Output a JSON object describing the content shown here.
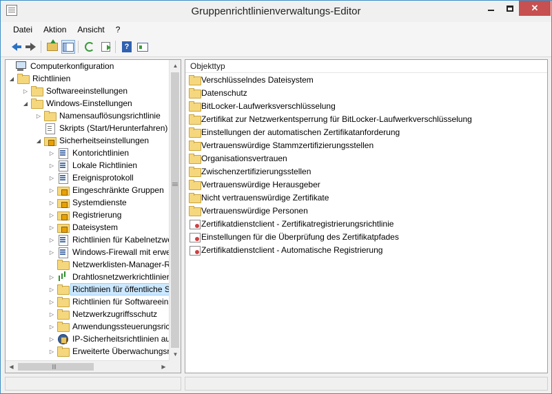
{
  "window": {
    "title": "Gruppenrichtlinienverwaltungs-Editor"
  },
  "menu": [
    {
      "label": "Datei"
    },
    {
      "label": "Aktion"
    },
    {
      "label": "Ansicht"
    },
    {
      "label": "?"
    }
  ],
  "toolbar": {
    "buttons": [
      "back-icon",
      "forward-icon",
      "folder-up-icon",
      "show-hide-tree-icon",
      "refresh-icon",
      "export-list-icon",
      "help-icon",
      "properties-icon"
    ]
  },
  "tree": {
    "items": [
      {
        "label": "Computerkonfiguration",
        "icon": "computer-icon",
        "expander": ""
      },
      {
        "label": "Richtlinien",
        "icon": "folder-icon",
        "expander": "◢"
      },
      {
        "label": "Softwareeinstellungen",
        "icon": "folder-icon",
        "expander": "▷"
      },
      {
        "label": "Windows-Einstellungen",
        "icon": "folder-icon",
        "expander": "◢"
      },
      {
        "label": "Namensauflösungsrichtlinie",
        "icon": "folder-icon",
        "expander": "▷"
      },
      {
        "label": "Skripts (Start/Herunterfahren)",
        "icon": "script-icon",
        "expander": ""
      },
      {
        "label": "Sicherheitseinstellungen",
        "icon": "security-folder-icon",
        "expander": "◢"
      },
      {
        "label": "Kontorichtlinien",
        "icon": "policy-icon",
        "expander": "▷"
      },
      {
        "label": "Lokale Richtlinien",
        "icon": "policy-icon",
        "expander": "▷"
      },
      {
        "label": "Ereignisprotokoll",
        "icon": "policy-icon",
        "expander": "▷"
      },
      {
        "label": "Eingeschränkte Gruppen",
        "icon": "security-folder-icon",
        "expander": "▷"
      },
      {
        "label": "Systemdienste",
        "icon": "security-folder-icon",
        "expander": "▷"
      },
      {
        "label": "Registrierung",
        "icon": "security-folder-icon",
        "expander": "▷"
      },
      {
        "label": "Dateisystem",
        "icon": "security-folder-icon",
        "expander": "▷"
      },
      {
        "label": "Richtlinien für Kabelnetzwe",
        "icon": "policy-icon",
        "expander": "▷"
      },
      {
        "label": "Windows-Firewall mit erwe",
        "icon": "policy-icon",
        "expander": "▷"
      },
      {
        "label": "Netzwerklisten-Manager-R",
        "icon": "folder-icon",
        "expander": ""
      },
      {
        "label": "Drahtlosnetzwerkrichtlinier",
        "icon": "wireless-icon",
        "expander": "▷"
      },
      {
        "label": "Richtlinien für öffentliche S",
        "icon": "folder-icon",
        "expander": "▷",
        "selected": true
      },
      {
        "label": "Richtlinien für Softwareeins",
        "icon": "folder-icon",
        "expander": "▷"
      },
      {
        "label": "Netzwerkzugriffsschutz",
        "icon": "folder-icon",
        "expander": "▷"
      },
      {
        "label": "Anwendungssteuerungsric",
        "icon": "folder-icon",
        "expander": "▷"
      },
      {
        "label": "IP-Sicherheitsrichtlinien au",
        "icon": "ipsec-icon",
        "expander": "▷"
      },
      {
        "label": "Erweiterte Überwachungsri",
        "icon": "folder-icon",
        "expander": "▷"
      }
    ]
  },
  "list": {
    "column_header": "Objekttyp",
    "items": [
      {
        "label": "Verschlüsselndes Dateisystem",
        "icon": "folder-icon"
      },
      {
        "label": "Datenschutz",
        "icon": "folder-icon"
      },
      {
        "label": "BitLocker-Laufwerksverschlüsselung",
        "icon": "folder-icon"
      },
      {
        "label": "Zertifikat zur Netzwerkentsperrung für BitLocker-Laufwerkverschlüsselung",
        "icon": "folder-icon"
      },
      {
        "label": "Einstellungen der automatischen Zertifikatanforderung",
        "icon": "folder-icon"
      },
      {
        "label": "Vertrauenswürdige Stammzertifizierungsstellen",
        "icon": "folder-icon"
      },
      {
        "label": "Organisationsvertrauen",
        "icon": "folder-icon"
      },
      {
        "label": "Zwischenzertifizierungsstellen",
        "icon": "folder-icon"
      },
      {
        "label": "Vertrauenswürdige Herausgeber",
        "icon": "folder-icon"
      },
      {
        "label": "Nicht vertrauenswürdige Zertifikate",
        "icon": "folder-icon"
      },
      {
        "label": "Vertrauenswürdige Personen",
        "icon": "folder-icon"
      },
      {
        "label": "Zertifikatdienstclient - Zertifikatregistrierungsrichtlinie",
        "icon": "certificate-icon"
      },
      {
        "label": "Einstellungen für die Überprüfung des Zertifikatpfades",
        "icon": "certificate-icon"
      },
      {
        "label": "Zertifikatdienstclient - Automatische Registrierung",
        "icon": "certificate-icon"
      }
    ]
  },
  "colors": {
    "selection": "#cce8ff",
    "accent": "#3c8ec6",
    "close": "#c75050"
  }
}
